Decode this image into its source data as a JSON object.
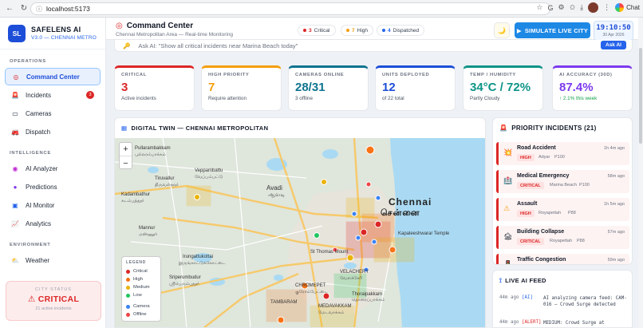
{
  "browser": {
    "url": "localhost:5173",
    "chat_label": "Chat"
  },
  "brand": {
    "logo": "SL",
    "name": "SAFELENS AI",
    "version": "V3.0 — CHENNAI METRO"
  },
  "sidebar": {
    "sections": [
      {
        "label": "OPERATIONS",
        "items": [
          {
            "label": "Command Center",
            "icon": "target-icon",
            "glyph": "◎",
            "active": true
          },
          {
            "label": "Incidents",
            "icon": "siren-icon",
            "glyph": "🚨",
            "badge": "3"
          },
          {
            "label": "Cameras",
            "icon": "camera-icon",
            "glyph": "▭"
          },
          {
            "label": "Dispatch",
            "icon": "truck-icon",
            "glyph": "🚒"
          }
        ]
      },
      {
        "label": "INTELLIGENCE",
        "items": [
          {
            "label": "AI Analyzer",
            "icon": "brain-icon",
            "glyph": "◉"
          },
          {
            "label": "Predictions",
            "icon": "crystal-ball-icon",
            "glyph": "●"
          },
          {
            "label": "AI Monitor",
            "icon": "monitor-icon",
            "glyph": "▣"
          },
          {
            "label": "Analytics",
            "icon": "chart-icon",
            "glyph": "📈"
          }
        ]
      },
      {
        "label": "ENVIRONMENT",
        "items": [
          {
            "label": "Weather",
            "icon": "weather-icon",
            "glyph": "⛅"
          }
        ]
      }
    ],
    "city_status": {
      "label": "CITY STATUS",
      "value": "⚠ CRITICAL",
      "sub": "21 active incidents"
    }
  },
  "header": {
    "title": "Command Center",
    "subtitle": "Chennai Metropolitan Area — Real-time Monitoring",
    "pills": [
      {
        "count": "3",
        "label": "Critical",
        "color": "#dc2626"
      },
      {
        "count": "7",
        "label": "High",
        "color": "#f59e0b"
      },
      {
        "count": "4",
        "label": "Dispatched",
        "color": "#2563eb"
      }
    ],
    "simulate_label": "SIMULATE LIVE CITY",
    "clock_time": "19:10:50",
    "clock_date": "30 Apr 2026"
  },
  "ask": {
    "placeholder": "Ask AI: \"Show all critical incidents near Marina Beach today\"",
    "button": "Ask AI"
  },
  "kpis": [
    {
      "label": "CRITICAL",
      "value": "3",
      "sub": "Active incidents",
      "color": "#dc2626"
    },
    {
      "label": "HIGH PRIORITY",
      "value": "7",
      "sub": "Require attention",
      "color": "#f59e0b"
    },
    {
      "label": "CAMERAS ONLINE",
      "value": "28/31",
      "sub": "3 offline",
      "color": "#0e7490"
    },
    {
      "label": "UNITS DEPLOYED",
      "value": "12",
      "sub": "of 22 total",
      "color": "#1d4ed8"
    },
    {
      "label": "TEMP / HUMIDITY",
      "value": "34°C / 72%",
      "sub": "Partly Cloudy",
      "color": "#0d9488"
    },
    {
      "label": "AI ACCURACY (30D)",
      "value": "87.4%",
      "sub": "↑ 2.1% this week",
      "color": "#7c3aed"
    }
  ],
  "map": {
    "title": "DIGITAL TWIN — CHENNAI METROPOLITAN",
    "places": [
      {
        "name": "Pullarambakkam",
        "tamil": "புல்லரம்பாக்கம்"
      },
      {
        "name": "Tiruvallur",
        "tamil": "திருவள்ளூர்"
      },
      {
        "name": "Veppambattu",
        "tamil": "வேப்பம்பட்டு"
      },
      {
        "name": "Avadi",
        "tamil": "ஆவடி"
      },
      {
        "name": "Kadambathur",
        "tamil": "கடம்பத்தூர்"
      },
      {
        "name": "Chennai",
        "tamil": "சென்னை"
      },
      {
        "name": "Mannur",
        "tamil": "மண்ணூர்"
      },
      {
        "name": "Sriperumbudur",
        "tamil": "ஸ்ரீபெரும்புதூர்"
      },
      {
        "name": "Irungattukottai",
        "tamil": "இருங்காட்டுக்கோட்டை"
      },
      {
        "name": "St Thomas Mount",
        "tamil": ""
      },
      {
        "name": "VELACHERY",
        "tamil": "வேளச்சேரி"
      },
      {
        "name": "CHROMEPET",
        "tamil": "குரோம்பேட்டை"
      },
      {
        "name": "TAMBARAM",
        "tamil": ""
      },
      {
        "name": "MEDAVAKKAM",
        "tamil": "மேடவாக்கம்"
      },
      {
        "name": "Thoraipakkam",
        "tamil": "தொரைப்பாக்கம்"
      },
      {
        "name": "Kapaleeshwarar Temple",
        "tamil": ""
      }
    ],
    "legend": {
      "title": "LEGEND",
      "items": [
        {
          "label": "Critical",
          "color": "#dc2626"
        },
        {
          "label": "High",
          "color": "#f97316"
        },
        {
          "label": "Medium",
          "color": "#eab308"
        },
        {
          "label": "Low",
          "color": "#22c55e"
        }
      ],
      "items2": [
        {
          "label": "Camera",
          "color": "#3b82f6"
        },
        {
          "label": "Offline",
          "color": "#ef4444"
        }
      ]
    }
  },
  "priority": {
    "title": "PRIORITY INCIDENTS (21)",
    "items": [
      {
        "name": "Road Accident",
        "tag": "HIGH",
        "location": "Adyar",
        "score": "P100",
        "ago": "1h 4m ago",
        "glyph": "💥"
      },
      {
        "name": "Medical Emergency",
        "tag": "CRITICAL",
        "location": "Marina Beach",
        "score": "P100",
        "ago": "58m ago",
        "glyph": "🏥"
      },
      {
        "name": "Assault",
        "tag": "HIGH",
        "location": "Royapettah",
        "score": "P88",
        "ago": "1h 5m ago",
        "glyph": "⚠"
      },
      {
        "name": "Building Collapse",
        "tag": "CRITICAL",
        "location": "Royapettah",
        "score": "P88",
        "ago": "57m ago",
        "glyph": "🏚"
      },
      {
        "name": "Traffic Congestion",
        "tag": "",
        "location": "",
        "score": "",
        "ago": "59m ago",
        "glyph": "🚦"
      }
    ]
  },
  "feed": {
    "title": "LIVE AI FEED",
    "rows": [
      {
        "ago": "44m ago",
        "tag": "[AI]",
        "msg": "AI analyzing camera feed: CAM-016 — Crowd Surge detected",
        "color": "#2563eb"
      },
      {
        "ago": "44m ago",
        "tag": "[ALERT]",
        "msg": "MEDIUM: Crowd Surge at",
        "color": "#dc2626"
      }
    ]
  }
}
